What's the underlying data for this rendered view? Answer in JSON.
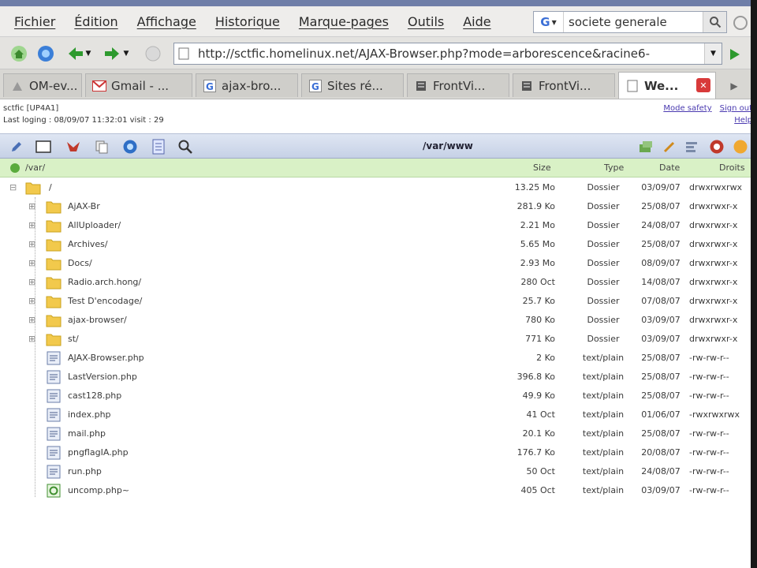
{
  "menu": [
    "Fichier",
    "Édition",
    "Affichage",
    "Historique",
    "Marque-pages",
    "Outils",
    "Aide"
  ],
  "search": {
    "engine": "G",
    "value": "societe generale"
  },
  "url": "http://sctfic.homelinux.net/AJAX-Browser.php?mode=arborescence&racine6-",
  "tabs": [
    {
      "label": "OM-ev...",
      "icon": "generic-page-icon",
      "active": false
    },
    {
      "label": "Gmail - ...",
      "icon": "gmail-icon",
      "active": false
    },
    {
      "label": "ajax-bro...",
      "icon": "google-icon",
      "active": false
    },
    {
      "label": "Sites ré...",
      "icon": "google-icon",
      "active": false
    },
    {
      "label": "FrontVi...",
      "icon": "frontview-icon",
      "active": false
    },
    {
      "label": "FrontVi...",
      "icon": "frontview-icon",
      "active": false
    },
    {
      "label": "We...",
      "icon": "page-icon",
      "active": true
    }
  ],
  "info": {
    "line1": "sctfic [UP4A1]",
    "line2": "Last loging : 08/09/07 11:32:01  visit : 29"
  },
  "links": {
    "safety": "Mode safety",
    "signout": "Sign out",
    "help": "Help"
  },
  "toolbar": {
    "path": "/var/www"
  },
  "colors": {
    "header_bg": "#d9f1c6",
    "toolbar_bg": "#c6d1e6",
    "folder": "#f2c94c"
  },
  "columns": {
    "name": "/var/",
    "size": "Size",
    "type": "Type",
    "date": "Date",
    "perms": "Droits"
  },
  "root": {
    "name": "/",
    "size": "13.25 Mo",
    "type": "Dossier",
    "date": "03/09/07",
    "perms": "drwxrwxrwx"
  },
  "items": [
    {
      "name": "AjAX-Br",
      "size": "281.9 Ko",
      "type": "Dossier",
      "date": "25/08/07",
      "perms": "drwxrwxr-x",
      "kind": "folder"
    },
    {
      "name": "AllUploader/",
      "size": "2.21 Mo",
      "type": "Dossier",
      "date": "24/08/07",
      "perms": "drwxrwxr-x",
      "kind": "folder"
    },
    {
      "name": "Archives/",
      "size": "5.65 Mo",
      "type": "Dossier",
      "date": "25/08/07",
      "perms": "drwxrwxr-x",
      "kind": "folder"
    },
    {
      "name": "Docs/",
      "size": "2.93 Mo",
      "type": "Dossier",
      "date": "08/09/07",
      "perms": "drwxrwxr-x",
      "kind": "folder"
    },
    {
      "name": "Radio.arch.hong/",
      "size": "280 Oct",
      "type": "Dossier",
      "date": "14/08/07",
      "perms": "drwxrwxr-x",
      "kind": "folder"
    },
    {
      "name": "Test D'encodage/",
      "size": "25.7 Ko",
      "type": "Dossier",
      "date": "07/08/07",
      "perms": "drwxrwxr-x",
      "kind": "folder"
    },
    {
      "name": "ajax-browser/",
      "size": "780 Ko",
      "type": "Dossier",
      "date": "03/09/07",
      "perms": "drwxrwxr-x",
      "kind": "folder"
    },
    {
      "name": "st/",
      "size": "771 Ko",
      "type": "Dossier",
      "date": "03/09/07",
      "perms": "drwxrwxr-x",
      "kind": "folder"
    },
    {
      "name": "AJAX-Browser.php",
      "size": "2 Ko",
      "type": "text/plain",
      "date": "25/08/07",
      "perms": "-rw-rw-r--",
      "kind": "file"
    },
    {
      "name": "LastVersion.php",
      "size": "396.8 Ko",
      "type": "text/plain",
      "date": "25/08/07",
      "perms": "-rw-rw-r--",
      "kind": "file"
    },
    {
      "name": "cast128.php",
      "size": "49.9 Ko",
      "type": "text/plain",
      "date": "25/08/07",
      "perms": "-rw-rw-r--",
      "kind": "file"
    },
    {
      "name": "index.php",
      "size": "41 Oct",
      "type": "text/plain",
      "date": "01/06/07",
      "perms": "-rwxrwxrwx",
      "kind": "file"
    },
    {
      "name": "mail.php",
      "size": "20.1 Ko",
      "type": "text/plain",
      "date": "25/08/07",
      "perms": "-rw-rw-r--",
      "kind": "file"
    },
    {
      "name": "pngflagIA.php",
      "size": "176.7 Ko",
      "type": "text/plain",
      "date": "20/08/07",
      "perms": "-rw-rw-r--",
      "kind": "file"
    },
    {
      "name": "run.php",
      "size": "50 Oct",
      "type": "text/plain",
      "date": "24/08/07",
      "perms": "-rw-rw-r--",
      "kind": "file"
    },
    {
      "name": "uncomp.php~",
      "size": "405 Oct",
      "type": "text/plain",
      "date": "03/09/07",
      "perms": "-rw-rw-r--",
      "kind": "file-alt"
    }
  ]
}
